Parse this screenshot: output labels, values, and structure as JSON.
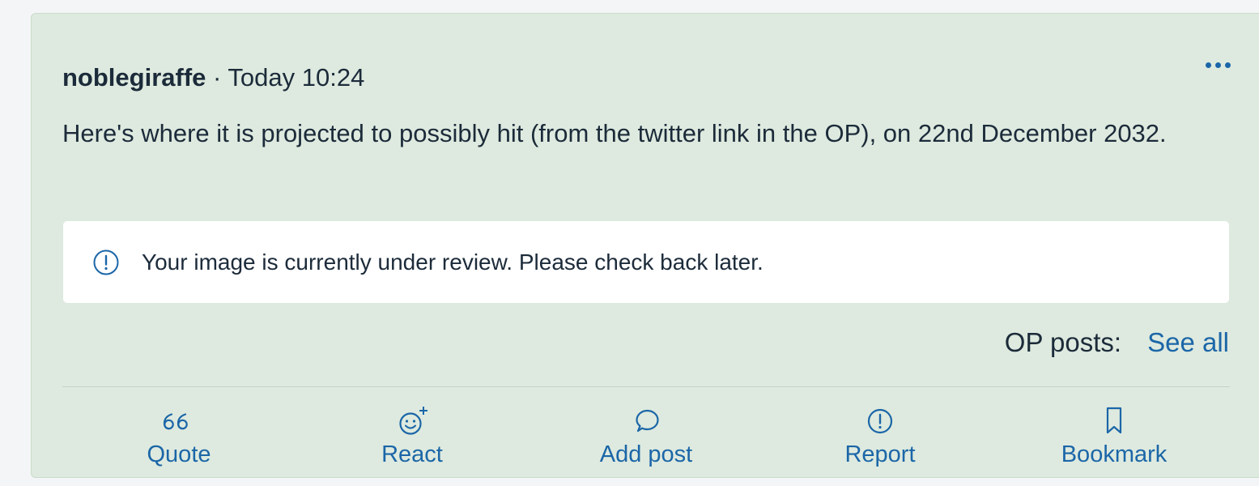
{
  "post": {
    "author": "noblegiraffe",
    "separator": " · ",
    "timestamp": "Today 10:24",
    "body": "Here's where it is projected to possibly hit (from the twitter link in the OP), on 22nd December 2032.",
    "notice": {
      "icon": "info-circle-icon",
      "text": "Your image is currently under review. Please check back later."
    },
    "op_posts": {
      "label": "OP posts:",
      "link": "See all"
    },
    "actions": [
      {
        "label": "Quote",
        "icon": "quote-icon"
      },
      {
        "label": "React",
        "icon": "react-smiley-icon"
      },
      {
        "label": "Add post",
        "icon": "speech-bubble-icon"
      },
      {
        "label": "Report",
        "icon": "exclamation-circle-icon"
      },
      {
        "label": "Bookmark",
        "icon": "bookmark-icon"
      }
    ]
  },
  "colors": {
    "post_background": "#deeadf",
    "accent": "#1b66a8",
    "text": "#1c2b3a",
    "notice_background": "#ffffff"
  }
}
